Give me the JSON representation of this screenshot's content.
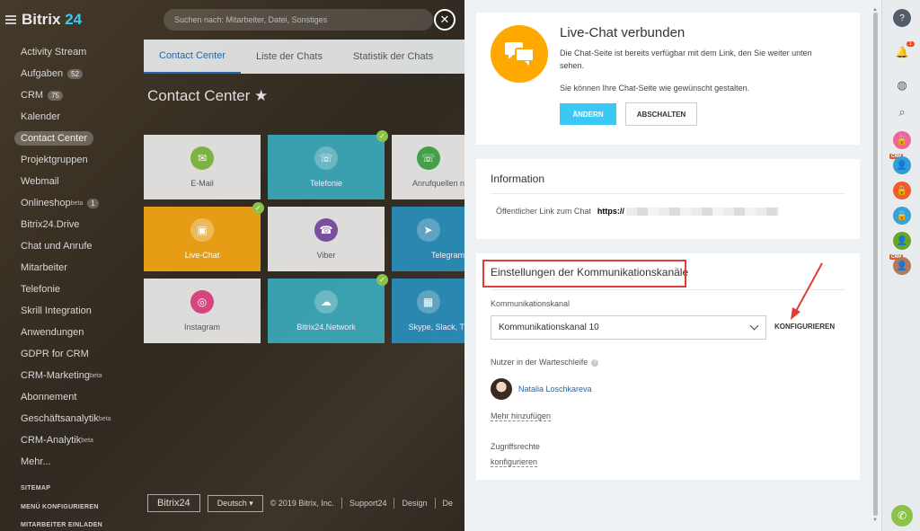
{
  "header": {
    "brand_main": "Bitrix",
    "brand_num": "24",
    "search_placeholder": "Suchen nach: Mitarbeiter, Datei, Sonstiges"
  },
  "sidebar": {
    "items": [
      {
        "label": "Activity Stream"
      },
      {
        "label": "Aufgaben",
        "badge": "52"
      },
      {
        "label": "CRM",
        "badge": "75"
      },
      {
        "label": "Kalender"
      },
      {
        "label": "Contact Center"
      },
      {
        "label": "Projektgruppen"
      },
      {
        "label": "Webmail"
      },
      {
        "label": "Onlineshop",
        "sup": "beta",
        "badge": "1"
      },
      {
        "label": "Bitrix24.Drive"
      },
      {
        "label": "Chat und Anrufe"
      },
      {
        "label": "Mitarbeiter"
      },
      {
        "label": "Telefonie"
      },
      {
        "label": "Skrill Integration"
      },
      {
        "label": "Anwendungen"
      },
      {
        "label": "GDPR for CRM"
      },
      {
        "label": "CRM-Marketing",
        "sup": "beta"
      },
      {
        "label": "Abonnement"
      },
      {
        "label": "Geschäftsanalytik",
        "sup": "beta"
      },
      {
        "label": "CRM-Analytik",
        "sup": "beta"
      },
      {
        "label": "Mehr..."
      }
    ],
    "sitemap": "SITEMAP",
    "menu_config": "MENÜ KONFIGURIEREN",
    "invite": "MITARBEITER EINLADEN"
  },
  "background_page": {
    "tabs": [
      "Contact Center",
      "Liste der Chats",
      "Statistik der Chats"
    ],
    "title": "Contact Center ★",
    "tiles": [
      {
        "label": "E-Mail"
      },
      {
        "label": "Telefonie"
      },
      {
        "label": "Anrufquellen n"
      },
      {
        "label": "Live-Chat"
      },
      {
        "label": "Viber"
      },
      {
        "label": "Telegram"
      },
      {
        "label": "Instagram"
      },
      {
        "label": "Bitrix24.Network"
      },
      {
        "label": "Skype, Slack, T"
      }
    ],
    "footer": {
      "logo": "Bitrix24",
      "lang": "Deutsch",
      "copyright": "© 2019 Bitrix, Inc.",
      "support": "Support24",
      "design": "Design",
      "more": "De"
    }
  },
  "panel": {
    "status_card": {
      "title": "Live-Chat verbunden",
      "desc": "Die Chat-Seite ist bereits verfügbar mit dem Link, den Sie weiter unten sehen.",
      "desc2": "Sie können Ihre Chat-Seite wie gewünscht gestalten.",
      "change_btn": "ÄNDERN",
      "off_btn": "ABSCHALTEN"
    },
    "info_card": {
      "title": "Information",
      "link_label": "Öffentlicher Link zum Chat",
      "link_prefix": "https://"
    },
    "channels_card": {
      "title": "Einstellungen der Kommunikationskanäle",
      "channel_label": "Kommunikationskanal",
      "channel_value": "Kommunikationskanal 10",
      "configure": "KONFIGURIEREN",
      "queue_label": "Nutzer in der Warteschleife",
      "user_name": "Natalia Loschkareva",
      "add_more": "Mehr hinzufügen",
      "access_label": "Zugriffsrechte",
      "access_link": "konfigurieren"
    }
  },
  "rightbar": {
    "notif_count": "1",
    "crm": "CRM"
  },
  "colors": {
    "accent": "#3bc8f5",
    "livechat_orange": "#ffa900",
    "highlight_red": "#e03c3c",
    "link_blue": "#2067b0"
  }
}
